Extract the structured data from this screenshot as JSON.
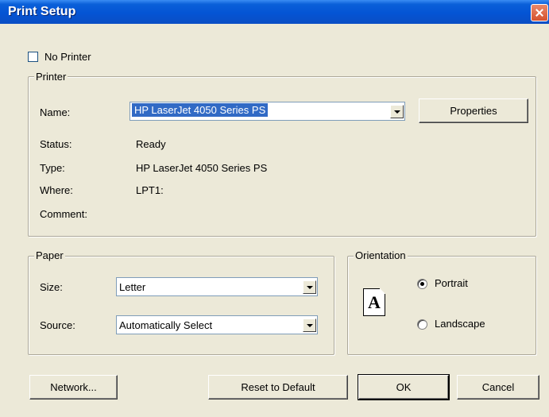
{
  "window": {
    "title": "Print Setup"
  },
  "no_printer": {
    "label": "No Printer",
    "checked": false
  },
  "printer": {
    "group_label": "Printer",
    "name_label": "Name:",
    "name_value": "HP LaserJet 4050 Series PS",
    "properties_label": "Properties",
    "status_label": "Status:",
    "status_value": "Ready",
    "type_label": "Type:",
    "type_value": "HP LaserJet 4050 Series PS",
    "where_label": "Where:",
    "where_value": "LPT1:",
    "comment_label": "Comment:",
    "comment_value": ""
  },
  "paper": {
    "group_label": "Paper",
    "size_label": "Size:",
    "size_value": "Letter",
    "source_label": "Source:",
    "source_value": "Automatically Select"
  },
  "orientation": {
    "group_label": "Orientation",
    "icon_letter": "A",
    "portrait_label": "Portrait",
    "landscape_label": "Landscape",
    "selected": "Portrait"
  },
  "buttons": {
    "network": "Network...",
    "reset": "Reset to Default",
    "ok": "OK",
    "cancel": "Cancel"
  },
  "colors": {
    "title_bar": "#0454d4",
    "dialog_bg": "#ece9d8",
    "selection": "#316ac5",
    "close_button": "#d5522f"
  }
}
